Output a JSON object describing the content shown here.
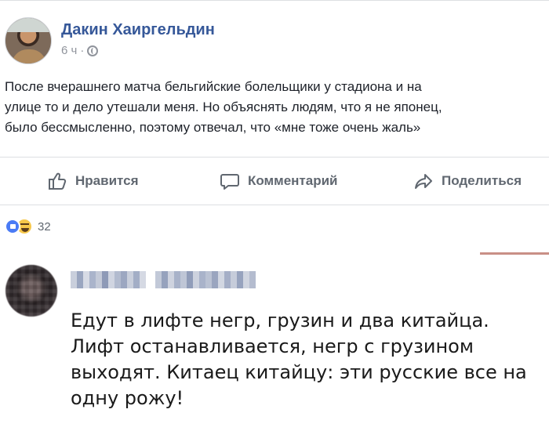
{
  "post": {
    "author": "Дакин Хаиргельдин",
    "time": "6 ч",
    "time_separator": "·",
    "text": "После вчерашнего матча бельгийские болельщики у стадиона и на\nулице то и дело утешали меня. Но объяснять людям, что я не японец,\nбыло бессмысленно, поэтому отвечал, что «мне тоже очень жаль»"
  },
  "actions": {
    "like_label": "Нравится",
    "comment_label": "Комментарий",
    "share_label": "Поделиться"
  },
  "reactions": {
    "count": "32",
    "icons": [
      "like-icon",
      "haha-icon"
    ]
  },
  "comment": {
    "text": "Едут в лифте негр, грузин и два китайца.\nЛифт останавливается, негр с грузином\nвыходят. Китаец китайцу: эти русские все на\nодну рожу!"
  },
  "colors": {
    "author_link": "#365899",
    "muted": "#90949c",
    "action_text": "#606770",
    "like_blue": "#4a7bf5",
    "haha_yellow": "#f7c84b",
    "accent_line": "#c98f86"
  }
}
